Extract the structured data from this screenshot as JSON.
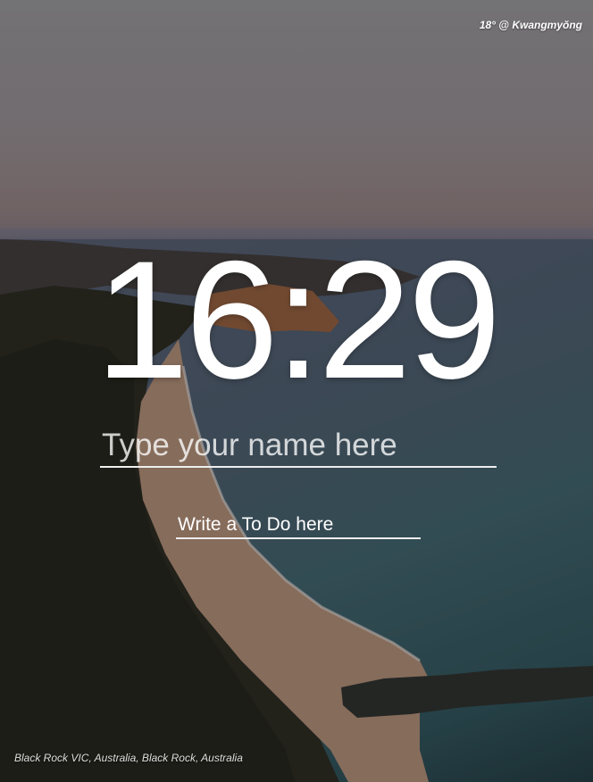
{
  "weather": {
    "text": "18° @ Kwangmyŏng"
  },
  "clock": {
    "hours": "16",
    "separator": ":",
    "minutes": "29"
  },
  "name_input": {
    "placeholder": "Type your name here",
    "value": ""
  },
  "todo_input": {
    "placeholder": "Write a To Do here",
    "value": ""
  },
  "photo": {
    "location": "Black Rock VIC, Australia, Black Rock, Australia"
  },
  "colors": {
    "text": "#ffffff",
    "underline": "#eeeeee"
  }
}
